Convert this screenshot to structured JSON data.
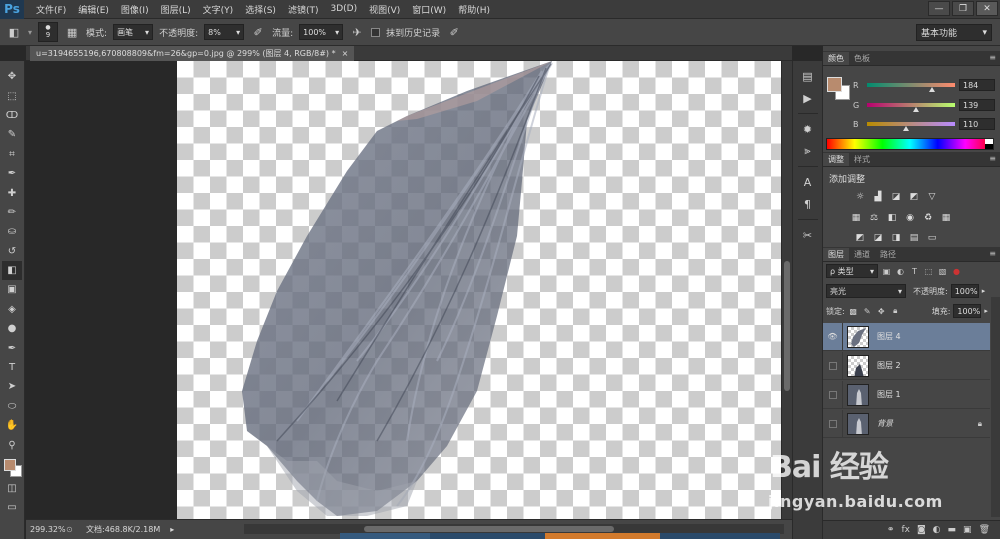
{
  "app": {
    "logo": "Ps",
    "menu": [
      "文件(F)",
      "编辑(E)",
      "图像(I)",
      "图层(L)",
      "文字(Y)",
      "选择(S)",
      "滤镜(T)",
      "3D(D)",
      "视图(V)",
      "窗口(W)",
      "帮助(H)"
    ],
    "window_controls": [
      "—",
      "❐",
      "✕"
    ]
  },
  "options": {
    "brush_size": "9",
    "mode_label": "模式:",
    "mode_value": "画笔",
    "opacity_label": "不透明度:",
    "opacity_value": "8%",
    "flow_label": "流量:",
    "flow_value": "100%",
    "erase_history_label": "抹到历史记录",
    "workspace": "基本功能"
  },
  "document": {
    "tab_title": "u=3194655196,670808809&fm=26&gp=0.jpg @ 299% (图层 4, RGB/8#) *",
    "tab_close": "×",
    "zoom": "299.32%",
    "doc_info": "文档:468.8K/2.18M"
  },
  "toolbar": {
    "icons": [
      "move-icon",
      "marquee-icon",
      "lasso-icon",
      "quick-select-icon",
      "crop-icon",
      "eyedropper-icon",
      "healing-icon",
      "brush-icon",
      "stamp-icon",
      "history-brush-icon",
      "eraser-icon",
      "gradient-icon",
      "blur-icon",
      "dodge-icon",
      "pen-icon",
      "type-icon",
      "path-select-icon",
      "shape-icon",
      "hand-icon",
      "zoom-icon"
    ],
    "glyphs": [
      "✥",
      "⬚",
      "ↀ",
      "✎",
      "⌗",
      "✒",
      "✚",
      "✏",
      "⛀",
      "↺",
      "◧",
      "▣",
      "◈",
      "●",
      "✒",
      "T",
      "➤",
      "⬭",
      "✋",
      "⚲"
    ]
  },
  "colors": {
    "foreground": "#b88b6e",
    "background": "#ffffff",
    "selected_layer": "#6b7e99"
  },
  "color_panel": {
    "tabs": [
      "颜色",
      "色板"
    ],
    "r_label": "R",
    "r_value": "184",
    "g_label": "G",
    "g_value": "139",
    "b_label": "B",
    "b_value": "110"
  },
  "adjustments": {
    "tabs": [
      "调整",
      "样式"
    ],
    "title": "添加调整"
  },
  "layers": {
    "tabs": [
      "图层",
      "通道",
      "路径"
    ],
    "filter": "ρ 类型",
    "blend_mode": "亮光",
    "opacity_label": "不透明度:",
    "opacity_value": "100%",
    "lock_label": "锁定:",
    "fill_label": "填充:",
    "fill_value": "100%",
    "items": [
      {
        "name": "图层 4",
        "visible": true
      },
      {
        "name": "图层 2",
        "visible": false
      },
      {
        "name": "图层 1",
        "visible": false
      },
      {
        "name": "背景",
        "visible": false
      }
    ]
  },
  "watermark": {
    "brand": "Bai 经验",
    "url": "jingyan.baidu.com"
  }
}
